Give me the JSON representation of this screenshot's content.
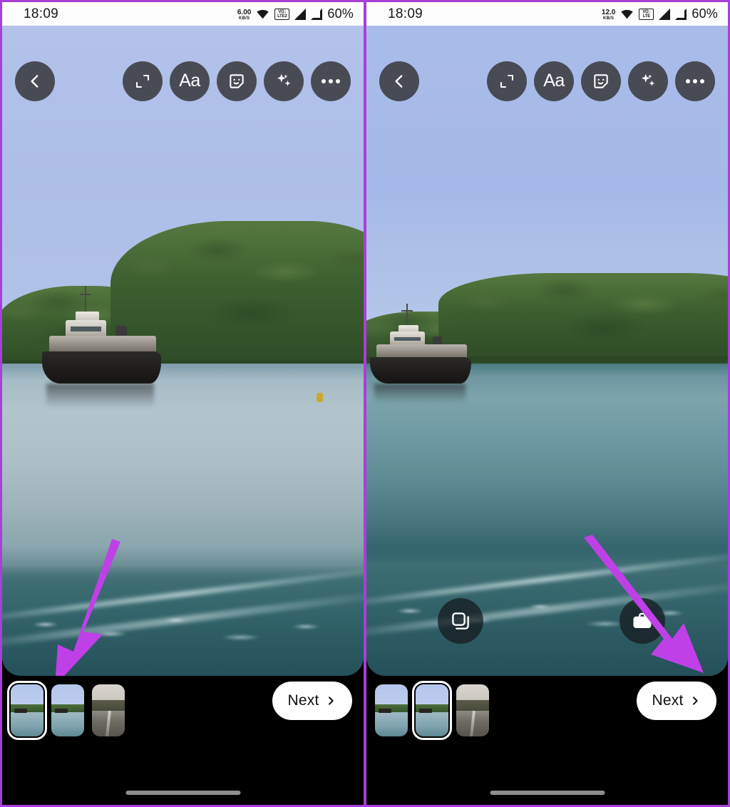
{
  "meta": {
    "app": "instagram-story-editor",
    "accent_purple": "#a93fd9",
    "arrow_color": "#c040e8",
    "panel_count": 2
  },
  "status_bar": {
    "left": {
      "time": "18:09",
      "net_speed_value": "6.00",
      "net_speed_unit": "KB/S",
      "wifi_icon": "wifi-icon",
      "volte_label": "VoLTE 2",
      "volte_line1": "VO↓",
      "volte_line2": "LTE2",
      "signal_1_icon": "signal-bars-icon",
      "signal_2_icon": "signal-bars-icon",
      "battery": "60%"
    },
    "right": {
      "time": "18:09",
      "net_speed_value": "12.0",
      "net_speed_unit": "KB/S",
      "wifi_icon": "wifi-icon",
      "volte_label": "VoLTE",
      "volte_line1": "VO↓",
      "volte_line2": "LTE",
      "signal_1_icon": "signal-bars-icon",
      "signal_2_icon": "signal-bars-icon",
      "battery": "60%"
    }
  },
  "toolbar": {
    "back_icon": "chevron-left-icon",
    "items": [
      {
        "name": "crop-resize-icon",
        "label": ""
      },
      {
        "name": "text-tool-icon",
        "label": "Aa"
      },
      {
        "name": "sticker-icon",
        "label": ""
      },
      {
        "name": "effects-sparkle-icon",
        "label": ""
      },
      {
        "name": "more-options-icon",
        "label": ""
      }
    ]
  },
  "canvas": {
    "left": {
      "photo_alt": "ferry boat on calm water with forested hillside",
      "sky_color": "#adbee9",
      "water_color": "#aebfc8",
      "wake_color": "#35656c",
      "float_buttons": []
    },
    "right": {
      "photo_alt": "ferry boat on water with wide forested shoreline",
      "sky_color": "#a5b9e8",
      "water_color": "#6f99a3",
      "wake_color": "#31616a",
      "float_buttons": [
        {
          "name": "layers-button",
          "icon": "layers-squares-icon"
        },
        {
          "name": "toolbox-button",
          "icon": "toolbox-icon"
        }
      ]
    }
  },
  "bottom_bar": {
    "left": {
      "thumbnails": [
        {
          "name": "thumbnail-1",
          "kind": "boat",
          "selected": true
        },
        {
          "name": "thumbnail-2",
          "kind": "boat",
          "selected": false
        },
        {
          "name": "thumbnail-3",
          "kind": "road",
          "selected": false
        }
      ],
      "next_label": "Next",
      "next_icon": "chevron-right-icon"
    },
    "right": {
      "thumbnails": [
        {
          "name": "thumbnail-1",
          "kind": "boat",
          "selected": false
        },
        {
          "name": "thumbnail-2",
          "kind": "boat",
          "selected": true
        },
        {
          "name": "thumbnail-3",
          "kind": "road",
          "selected": false
        }
      ],
      "next_label": "Next",
      "next_icon": "chevron-right-icon"
    }
  },
  "annotations": {
    "left_arrow": {
      "name": "annotation-arrow-to-thumbnails",
      "direction": "down-left",
      "points_at": "thumbnail-strip"
    },
    "right_arrow": {
      "name": "annotation-arrow-to-next",
      "direction": "down-right",
      "points_at": "next-button"
    }
  }
}
